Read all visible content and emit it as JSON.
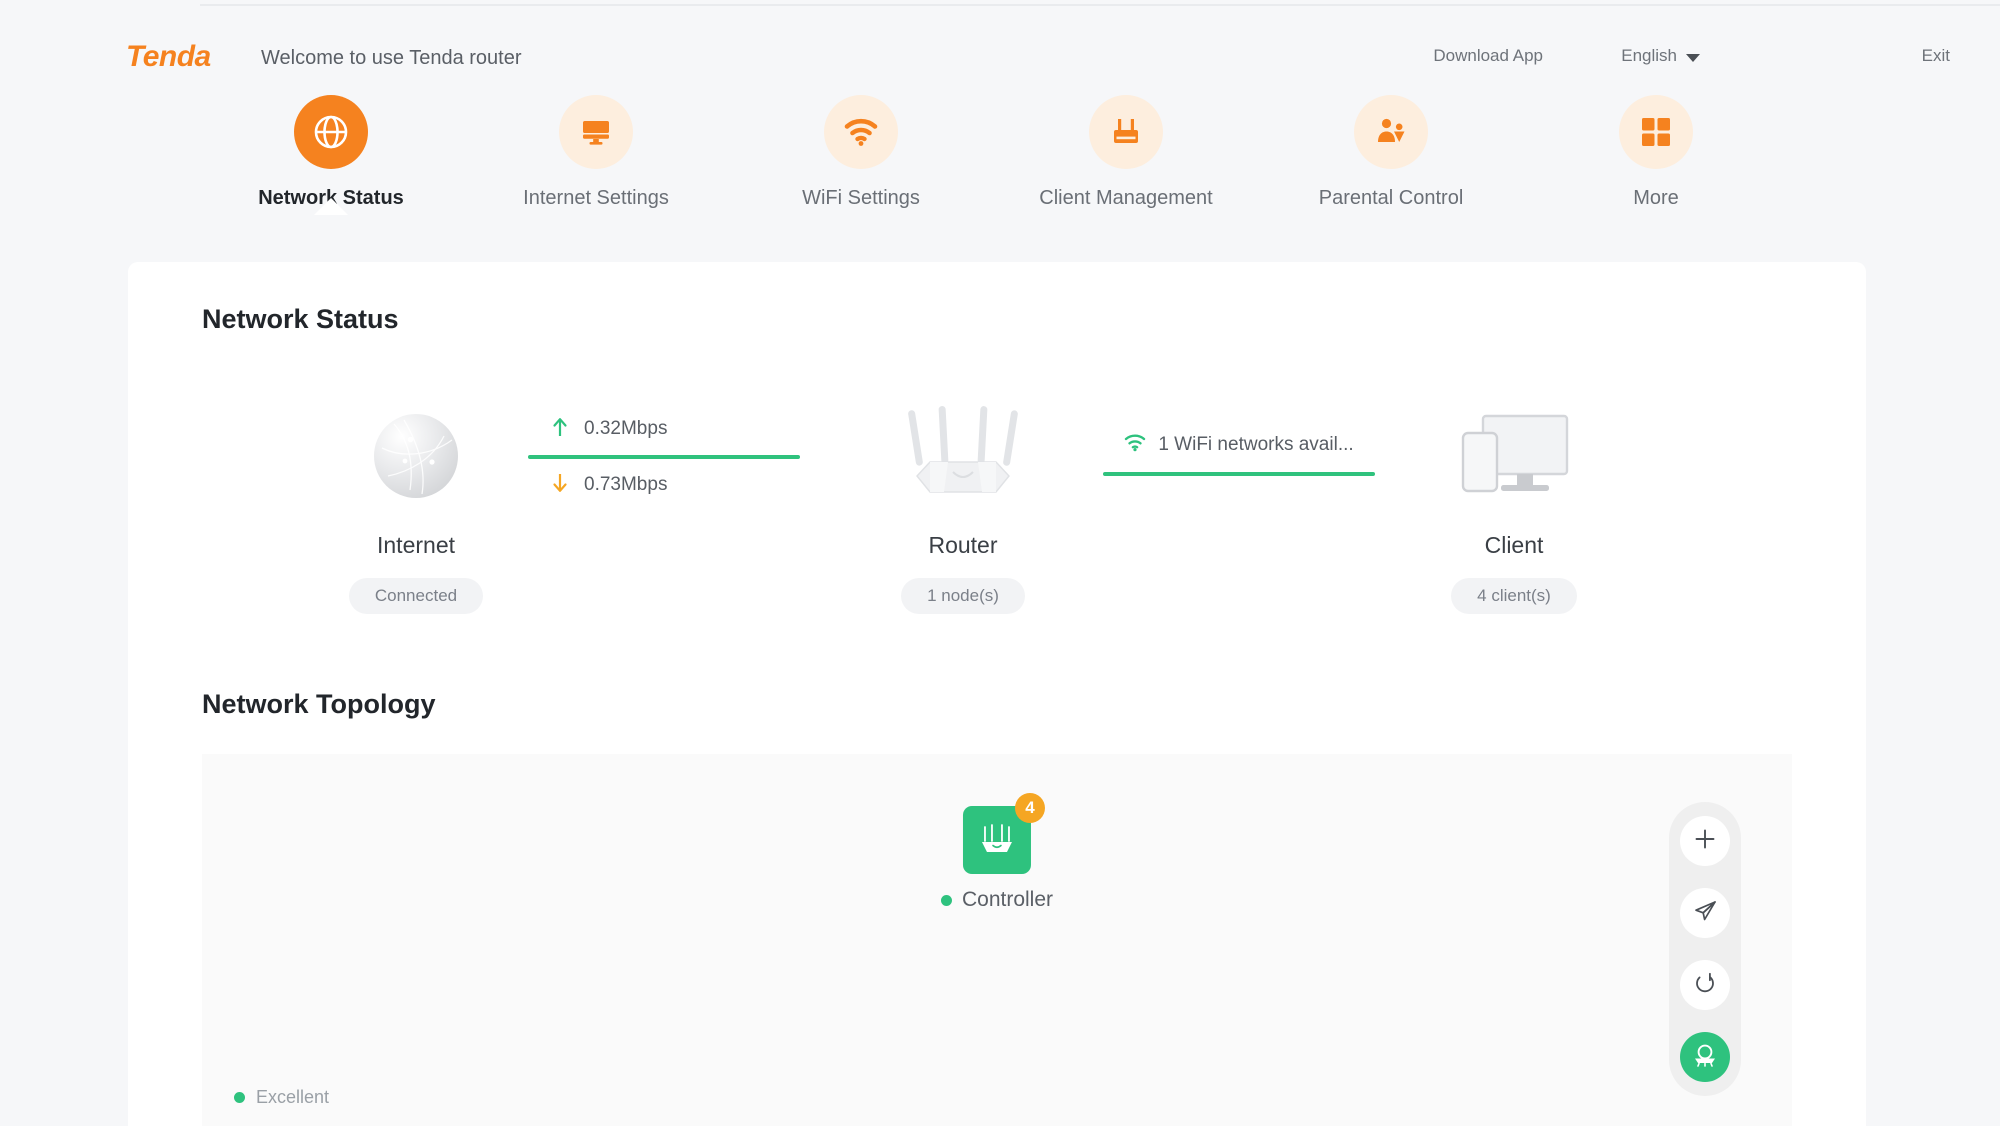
{
  "header": {
    "logo": "Tenda",
    "welcome": "Welcome to use Tenda router",
    "download_app": "Download App",
    "language": "English",
    "exit": "Exit"
  },
  "nav": {
    "items": [
      {
        "label": "Network Status",
        "icon": "globe-icon",
        "active": true
      },
      {
        "label": "Internet Settings",
        "icon": "monitor-icon",
        "active": false
      },
      {
        "label": "WiFi Settings",
        "icon": "wifi-icon",
        "active": false
      },
      {
        "label": "Client Management",
        "icon": "router-icon",
        "active": false
      },
      {
        "label": "Parental Control",
        "icon": "person-icon",
        "active": false
      },
      {
        "label": "More",
        "icon": "grid-icon",
        "active": false
      }
    ]
  },
  "sections": {
    "network_status_title": "Network Status",
    "network_topology_title": "Network Topology"
  },
  "status": {
    "internet": {
      "name": "Internet",
      "badge": "Connected",
      "icon": "globe-sphere-icon"
    },
    "router": {
      "name": "Router",
      "badge": "1 node(s)",
      "icon": "router-device-icon"
    },
    "client": {
      "name": "Client",
      "badge": "4 client(s)",
      "icon": "monitor-phone-icon"
    },
    "speed": {
      "upload": "0.32Mbps",
      "download": "0.73Mbps",
      "upload_icon": "arrow-up-icon",
      "download_icon": "arrow-down-icon"
    },
    "wifi": {
      "text": "1 WiFi networks avail...",
      "icon": "wifi-icon"
    }
  },
  "topology": {
    "controller": {
      "label": "Controller",
      "badge": "4",
      "status": "online"
    },
    "quality": "Excellent",
    "toolbar": [
      {
        "name": "add-node-button",
        "icon": "plus-icon"
      },
      {
        "name": "send-button",
        "icon": "paper-plane-icon"
      },
      {
        "name": "reboot-button",
        "icon": "power-icon"
      },
      {
        "name": "router-locate-button",
        "icon": "router-glyph-icon"
      }
    ]
  },
  "colors": {
    "brand": "#f5821f",
    "accent_green": "#2ec27e",
    "badge_orange": "#f5a623",
    "page_bg": "#f6f7f9"
  }
}
